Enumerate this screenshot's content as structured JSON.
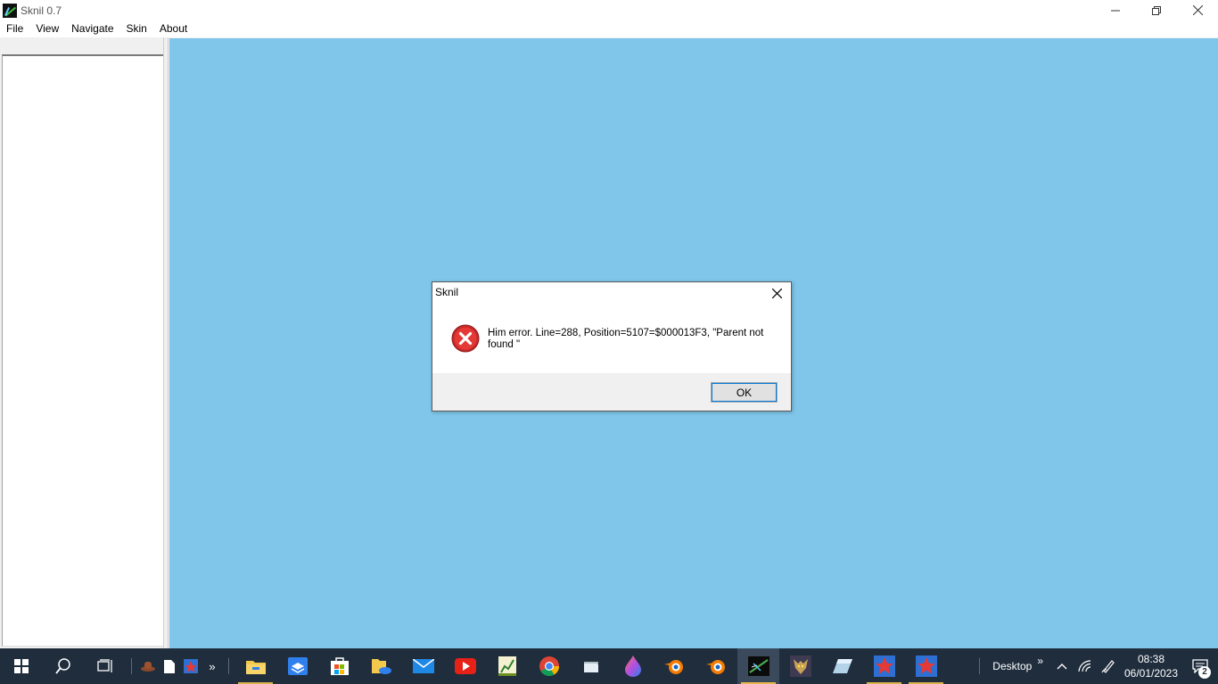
{
  "window": {
    "title": "Sknil 0.7"
  },
  "menu": {
    "items": [
      "File",
      "View",
      "Navigate",
      "Skin",
      "About"
    ]
  },
  "colors": {
    "main_panel": "#7fc6ea",
    "taskbar": "#1f2d3d",
    "error_red": "#d32f2f"
  },
  "dialog": {
    "title": "Sknil",
    "message": "Him error. Line=288, Position=5107=$000013F3, \"Parent not found \"",
    "ok_label": "OK",
    "icon": "error-icon"
  },
  "taskbar": {
    "pinned": [
      {
        "name": "file-explorer",
        "icon": "folder-icon"
      },
      {
        "name": "dropbox",
        "icon": "box-icon"
      },
      {
        "name": "microsoft-store",
        "icon": "store-icon"
      },
      {
        "name": "onedrive-files",
        "icon": "folder-cloud-icon"
      },
      {
        "name": "mail",
        "icon": "mail-icon"
      },
      {
        "name": "youtube",
        "icon": "youtube-icon"
      },
      {
        "name": "chart-app",
        "icon": "chart-icon"
      },
      {
        "name": "chrome",
        "icon": "chrome-icon"
      },
      {
        "name": "notes",
        "icon": "note-icon"
      },
      {
        "name": "paint-drop",
        "icon": "drop-icon"
      },
      {
        "name": "blender",
        "icon": "blender-icon"
      },
      {
        "name": "blender-2",
        "icon": "blender-icon"
      },
      {
        "name": "sknil",
        "icon": "sknil-icon"
      },
      {
        "name": "wolf-app",
        "icon": "wolf-icon"
      },
      {
        "name": "eraser-app",
        "icon": "eraser-icon"
      },
      {
        "name": "star-app",
        "icon": "star-icon"
      },
      {
        "name": "star-app-2",
        "icon": "star-icon"
      }
    ],
    "toolbar_label": "Desktop",
    "time": "08:38",
    "date": "06/01/2023",
    "notification_count": "2"
  }
}
